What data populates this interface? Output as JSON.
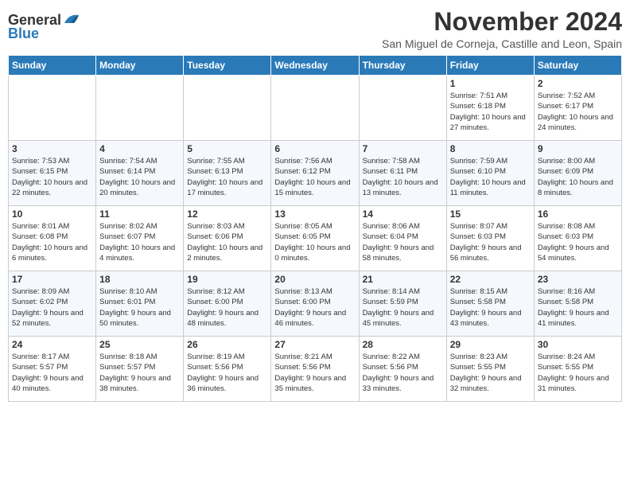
{
  "header": {
    "logo_general": "General",
    "logo_blue": "Blue",
    "month_title": "November 2024",
    "subtitle": "San Miguel de Corneja, Castille and Leon, Spain"
  },
  "days_of_week": [
    "Sunday",
    "Monday",
    "Tuesday",
    "Wednesday",
    "Thursday",
    "Friday",
    "Saturday"
  ],
  "weeks": [
    [
      {
        "day": "",
        "info": ""
      },
      {
        "day": "",
        "info": ""
      },
      {
        "day": "",
        "info": ""
      },
      {
        "day": "",
        "info": ""
      },
      {
        "day": "",
        "info": ""
      },
      {
        "day": "1",
        "info": "Sunrise: 7:51 AM\nSunset: 6:18 PM\nDaylight: 10 hours and 27 minutes."
      },
      {
        "day": "2",
        "info": "Sunrise: 7:52 AM\nSunset: 6:17 PM\nDaylight: 10 hours and 24 minutes."
      }
    ],
    [
      {
        "day": "3",
        "info": "Sunrise: 7:53 AM\nSunset: 6:15 PM\nDaylight: 10 hours and 22 minutes."
      },
      {
        "day": "4",
        "info": "Sunrise: 7:54 AM\nSunset: 6:14 PM\nDaylight: 10 hours and 20 minutes."
      },
      {
        "day": "5",
        "info": "Sunrise: 7:55 AM\nSunset: 6:13 PM\nDaylight: 10 hours and 17 minutes."
      },
      {
        "day": "6",
        "info": "Sunrise: 7:56 AM\nSunset: 6:12 PM\nDaylight: 10 hours and 15 minutes."
      },
      {
        "day": "7",
        "info": "Sunrise: 7:58 AM\nSunset: 6:11 PM\nDaylight: 10 hours and 13 minutes."
      },
      {
        "day": "8",
        "info": "Sunrise: 7:59 AM\nSunset: 6:10 PM\nDaylight: 10 hours and 11 minutes."
      },
      {
        "day": "9",
        "info": "Sunrise: 8:00 AM\nSunset: 6:09 PM\nDaylight: 10 hours and 8 minutes."
      }
    ],
    [
      {
        "day": "10",
        "info": "Sunrise: 8:01 AM\nSunset: 6:08 PM\nDaylight: 10 hours and 6 minutes."
      },
      {
        "day": "11",
        "info": "Sunrise: 8:02 AM\nSunset: 6:07 PM\nDaylight: 10 hours and 4 minutes."
      },
      {
        "day": "12",
        "info": "Sunrise: 8:03 AM\nSunset: 6:06 PM\nDaylight: 10 hours and 2 minutes."
      },
      {
        "day": "13",
        "info": "Sunrise: 8:05 AM\nSunset: 6:05 PM\nDaylight: 10 hours and 0 minutes."
      },
      {
        "day": "14",
        "info": "Sunrise: 8:06 AM\nSunset: 6:04 PM\nDaylight: 9 hours and 58 minutes."
      },
      {
        "day": "15",
        "info": "Sunrise: 8:07 AM\nSunset: 6:03 PM\nDaylight: 9 hours and 56 minutes."
      },
      {
        "day": "16",
        "info": "Sunrise: 8:08 AM\nSunset: 6:03 PM\nDaylight: 9 hours and 54 minutes."
      }
    ],
    [
      {
        "day": "17",
        "info": "Sunrise: 8:09 AM\nSunset: 6:02 PM\nDaylight: 9 hours and 52 minutes."
      },
      {
        "day": "18",
        "info": "Sunrise: 8:10 AM\nSunset: 6:01 PM\nDaylight: 9 hours and 50 minutes."
      },
      {
        "day": "19",
        "info": "Sunrise: 8:12 AM\nSunset: 6:00 PM\nDaylight: 9 hours and 48 minutes."
      },
      {
        "day": "20",
        "info": "Sunrise: 8:13 AM\nSunset: 6:00 PM\nDaylight: 9 hours and 46 minutes."
      },
      {
        "day": "21",
        "info": "Sunrise: 8:14 AM\nSunset: 5:59 PM\nDaylight: 9 hours and 45 minutes."
      },
      {
        "day": "22",
        "info": "Sunrise: 8:15 AM\nSunset: 5:58 PM\nDaylight: 9 hours and 43 minutes."
      },
      {
        "day": "23",
        "info": "Sunrise: 8:16 AM\nSunset: 5:58 PM\nDaylight: 9 hours and 41 minutes."
      }
    ],
    [
      {
        "day": "24",
        "info": "Sunrise: 8:17 AM\nSunset: 5:57 PM\nDaylight: 9 hours and 40 minutes."
      },
      {
        "day": "25",
        "info": "Sunrise: 8:18 AM\nSunset: 5:57 PM\nDaylight: 9 hours and 38 minutes."
      },
      {
        "day": "26",
        "info": "Sunrise: 8:19 AM\nSunset: 5:56 PM\nDaylight: 9 hours and 36 minutes."
      },
      {
        "day": "27",
        "info": "Sunrise: 8:21 AM\nSunset: 5:56 PM\nDaylight: 9 hours and 35 minutes."
      },
      {
        "day": "28",
        "info": "Sunrise: 8:22 AM\nSunset: 5:56 PM\nDaylight: 9 hours and 33 minutes."
      },
      {
        "day": "29",
        "info": "Sunrise: 8:23 AM\nSunset: 5:55 PM\nDaylight: 9 hours and 32 minutes."
      },
      {
        "day": "30",
        "info": "Sunrise: 8:24 AM\nSunset: 5:55 PM\nDaylight: 9 hours and 31 minutes."
      }
    ]
  ]
}
